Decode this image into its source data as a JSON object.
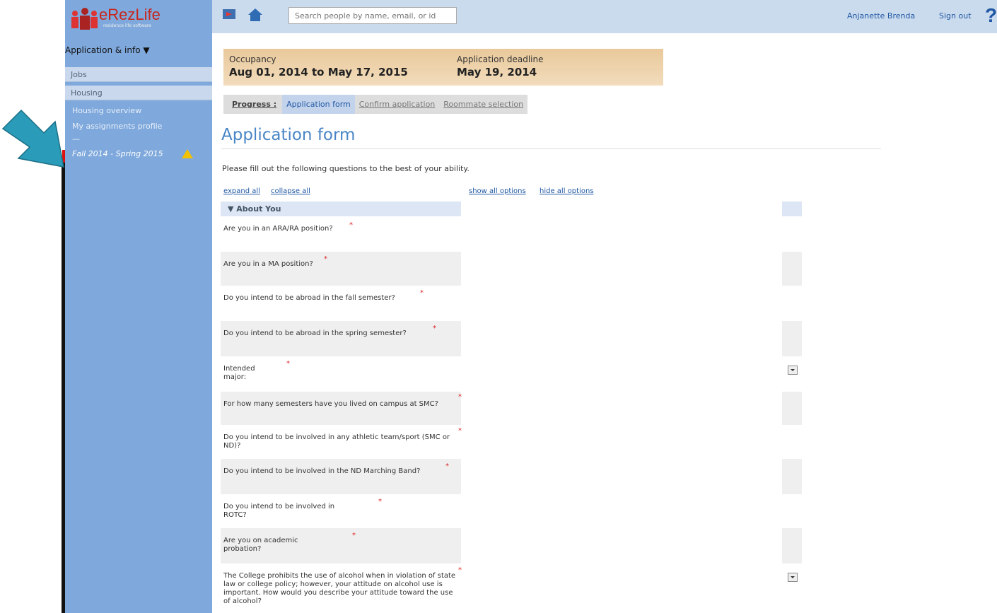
{
  "brand": {
    "name": "eRezLife",
    "tagline": "residence life software"
  },
  "sidebar": {
    "menu_title": "Application & info ▼",
    "items": [
      "Jobs",
      "Housing"
    ],
    "sublinks": [
      "Housing overview",
      "My assignments profile",
      "—"
    ],
    "term": "Fall 2014 - Spring 2015"
  },
  "header": {
    "search_placeholder": "Search people by name, email, or id",
    "user_name": "Anjanette Brenda",
    "sign_out": "Sign out",
    "help": "?"
  },
  "occupancy": {
    "label": "Occupancy",
    "value": "Aug 01, 2014 to May 17, 2015",
    "deadline_label": "Application deadline",
    "deadline_value": "May 19, 2014"
  },
  "progress": {
    "label": "Progress :",
    "steps": [
      "Application form",
      "Confirm application",
      "Roommate selection"
    ]
  },
  "page": {
    "title": "Application form",
    "intro": "Please fill out the following questions to the best of your ability.",
    "expand_all": "expand all",
    "collapse_all": "collapse all",
    "show_all_options": "show all options",
    "hide_all_options": "hide all options"
  },
  "form": {
    "section": "▼ About You",
    "questions": [
      "Are you in an ARA/RA position?",
      "Are you in a MA position?",
      "Do you intend to be abroad in the fall semester?",
      "Do you intend to be abroad in the spring semester?",
      "Intended major:",
      "For how many semesters have you lived on campus at SMC?",
      "Do you intend to be involved in any athletic team/sport (SMC or ND)?",
      "Do you intend to be involved in the ND Marching Band?",
      "Do you intend to be involved in ROTC?",
      "Are you on academic probation?",
      "The College prohibits the use of alcohol when in violation of state law or college policy; however, your attitude on alcohol use is important. How would you describe your attitude toward the use of alcohol?"
    ],
    "required_mark": "*"
  },
  "colors": {
    "sidebar": "#7fa9dc",
    "topbar": "#cbdbee",
    "accent": "#4a86c6",
    "arrow": "#2a9bb8",
    "occupancy": "#efd3aa"
  }
}
